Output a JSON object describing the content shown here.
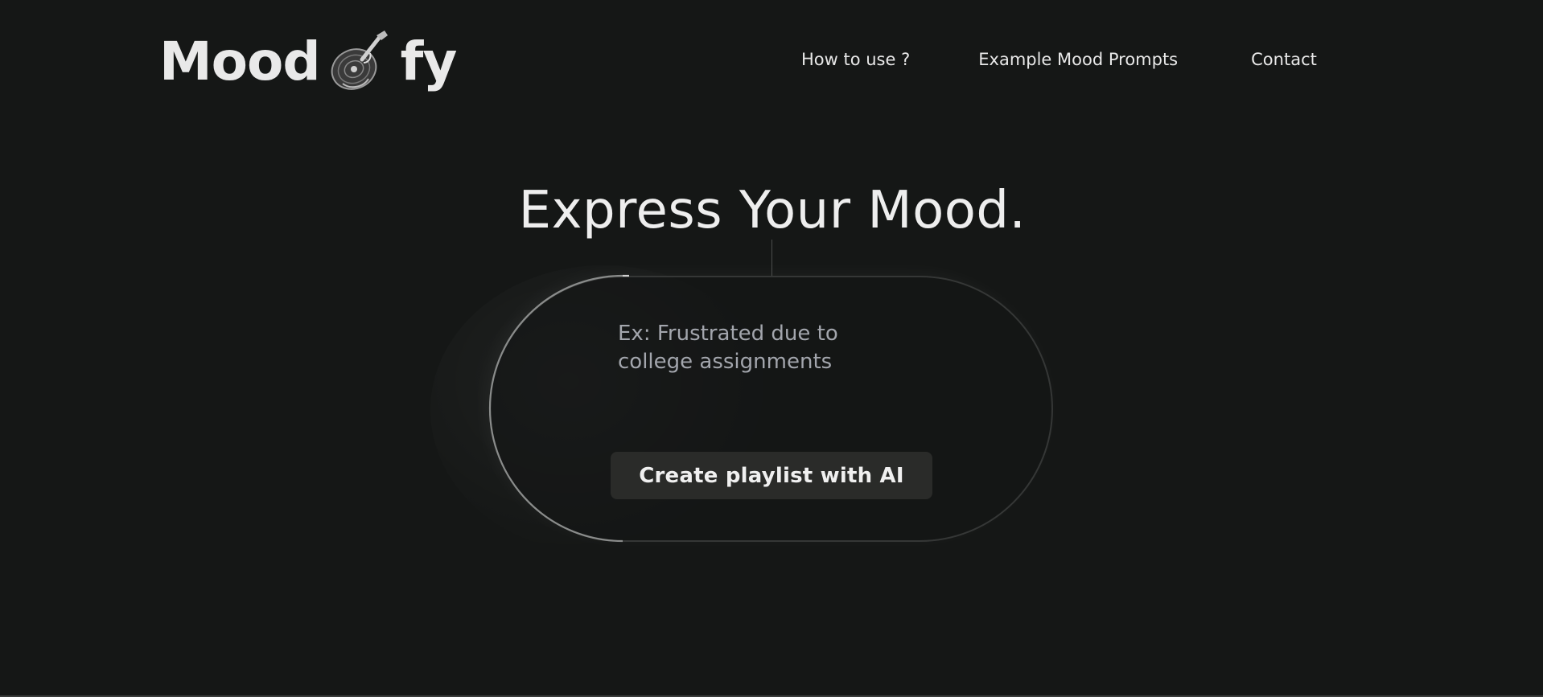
{
  "brand": {
    "name_part1": "Mood",
    "name_part2": "fy",
    "logo_glyph_icon": "guitar-vinyl-icon"
  },
  "nav": {
    "items": [
      {
        "label": "How to use ?"
      },
      {
        "label": "Example Mood Prompts"
      },
      {
        "label": "Contact"
      }
    ]
  },
  "hero": {
    "headline": "Express Your Mood."
  },
  "mood_form": {
    "input_value": "",
    "input_placeholder": "Ex: Frustrated due to college assignments",
    "submit_label": "Create playlist with AI"
  },
  "colors": {
    "background": "#151716",
    "text": "#e9e9e9",
    "placeholder": "#a3a6ad",
    "button_bg": "#2a2b29",
    "pill_border": "#353736"
  }
}
